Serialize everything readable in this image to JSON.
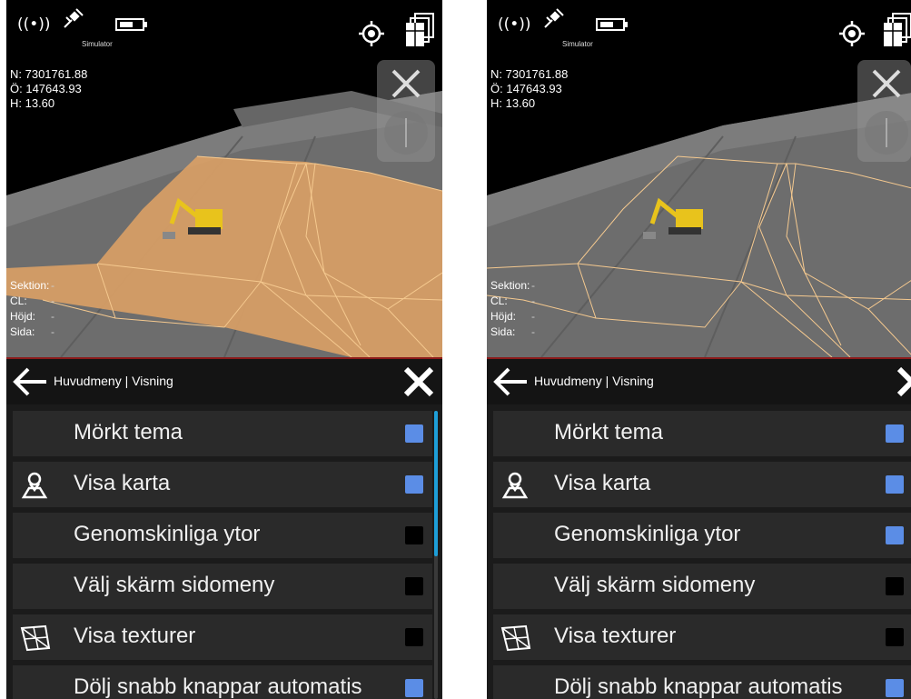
{
  "status": {
    "simulator_label": "Simulator",
    "icons": [
      "radio-signal-icon",
      "satellite-icon",
      "battery-icon",
      "locate-icon",
      "layers-icon"
    ]
  },
  "coords": {
    "north": "N: 7301761.88",
    "east": "Ö: 147643.93",
    "height": "H: 13.60"
  },
  "info": [
    {
      "key": "Sektion:",
      "value": "-"
    },
    {
      "key": "CL:",
      "value": "-"
    },
    {
      "key": "Höjd:",
      "value": "-"
    },
    {
      "key": "Sida:",
      "value": "-"
    }
  ],
  "header": {
    "breadcrumb": "Huvudmeny | Visning"
  },
  "left": {
    "items": [
      {
        "label": "Mörkt tema",
        "checked": true
      },
      {
        "label": "Visa karta",
        "checked": true,
        "icon": "map-pin-icon"
      },
      {
        "label": "Genomskinliga ytor",
        "checked": false
      },
      {
        "label": "Välj skärm sidomeny",
        "checked": false
      },
      {
        "label": "Visa texturer",
        "checked": false,
        "icon": "texture-icon"
      },
      {
        "label": "Dölj snabb knappar automatis",
        "checked": true
      }
    ]
  },
  "right": {
    "items": [
      {
        "label": "Mörkt tema",
        "checked": true
      },
      {
        "label": "Visa karta",
        "checked": true,
        "icon": "map-pin-icon"
      },
      {
        "label": "Genomskinliga ytor",
        "checked": true
      },
      {
        "label": "Välj skärm sidomeny",
        "checked": false
      },
      {
        "label": "Visa texturer",
        "checked": false,
        "icon": "texture-icon"
      },
      {
        "label": "Dölj snabb knappar automatis",
        "checked": true
      }
    ]
  },
  "colors": {
    "surface_fill": "#d9a066",
    "surface_line": "#f5c98f",
    "checkbox_on": "#5b8de6",
    "accent_line": "#8b1a1a",
    "scrollbar": "#1e9fd8"
  }
}
